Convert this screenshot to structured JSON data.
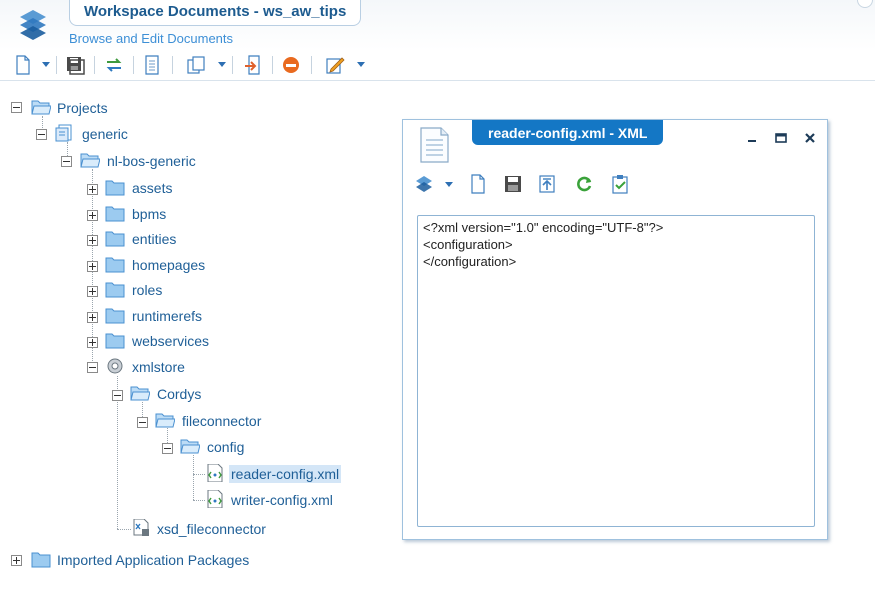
{
  "app": {
    "title": "Workspace Documents - ws_aw_tips",
    "subtitle": "Browse and Edit Documents"
  },
  "toolbar": {
    "items": [
      "new-document-icon",
      "save-all-icon",
      "synchronize-icon",
      "properties-icon",
      "copy-icon",
      "import-icon",
      "stop-icon",
      "edit-icon"
    ]
  },
  "tree": {
    "projects": "Projects",
    "generic": "generic",
    "nl_bos_generic": "nl-bos-generic",
    "assets": "assets",
    "bpms": "bpms",
    "entities": "entities",
    "homepages": "homepages",
    "roles": "roles",
    "runtimerefs": "runtimerefs",
    "webservices": "webservices",
    "xmlstore": "xmlstore",
    "cordys": "Cordys",
    "fileconnector": "fileconnector",
    "config": "config",
    "reader_config": "reader-config.xml",
    "writer_config": "writer-config.xml",
    "xsd_fileconnector": "xsd_fileconnector",
    "imported": "Imported Application Packages"
  },
  "xml_window": {
    "title": "reader-config.xml - XML",
    "content": "<?xml version=\"1.0\" encoding=\"UTF-8\"?>\n<configuration>\n</configuration>",
    "toolbar": [
      "workflow-icon",
      "new-icon",
      "save-icon",
      "export-icon",
      "refresh-icon",
      "validate-icon"
    ]
  },
  "colors": {
    "accent": "#1477c5",
    "link": "#1f5f97",
    "selected_bg": "#d4e6f7"
  }
}
